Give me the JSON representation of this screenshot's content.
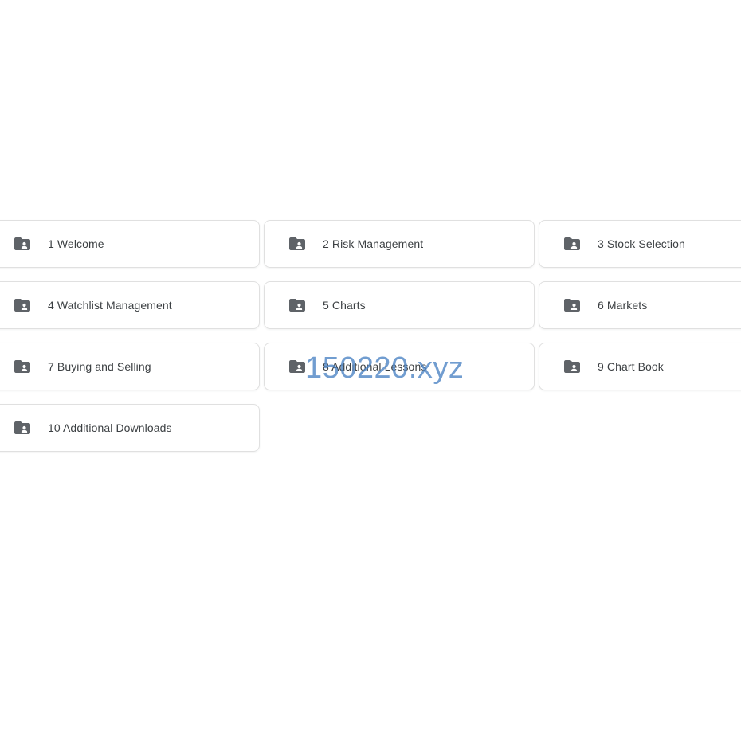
{
  "page": {
    "background_color": "#ffffff",
    "card_border_color": "#e0e0e0",
    "label_color": "#3c4043",
    "icon_color": "#5f6368"
  },
  "watermark": {
    "text": "150220.xyz",
    "color": "#4a82c4"
  },
  "folder_grid": {
    "icon_name": "shared-folder-icon",
    "items": [
      {
        "label": "1 Welcome"
      },
      {
        "label": "2 Risk Management"
      },
      {
        "label": "3 Stock Selection"
      },
      {
        "label": "4 Watchlist Management"
      },
      {
        "label": "5 Charts"
      },
      {
        "label": "6 Markets"
      },
      {
        "label": "7 Buying and Selling"
      },
      {
        "label": "8 Additional Lessons"
      },
      {
        "label": "9 Chart Book"
      },
      {
        "label": "10 Additional Downloads"
      }
    ]
  }
}
